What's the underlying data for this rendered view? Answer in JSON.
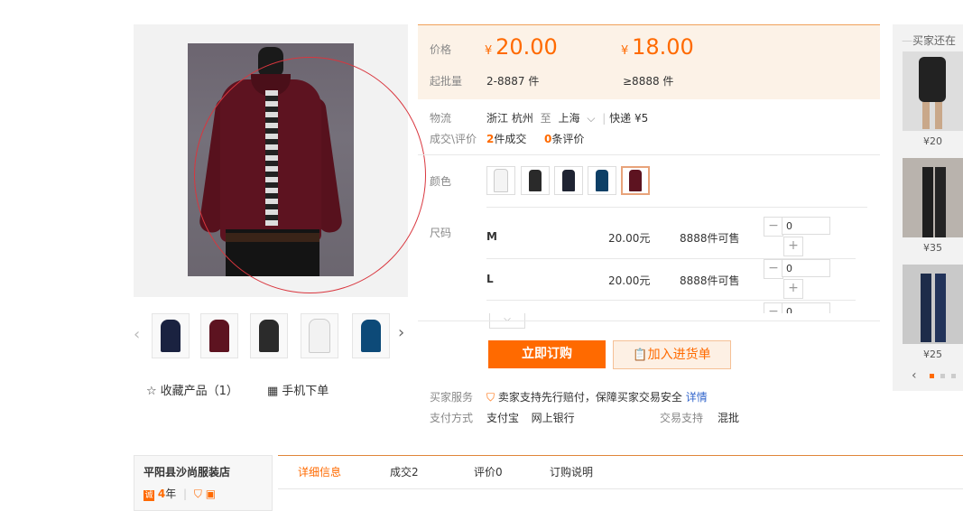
{
  "gallery": {
    "favorite_label": "收藏产品（1）",
    "mobile_order_label": "手机下单",
    "thumb_colors": [
      "#1a2240",
      "#5d1320",
      "#2b2b2b",
      "#f2f2f2",
      "#0d4a78"
    ]
  },
  "price": {
    "price_label": "价格",
    "currency": "¥",
    "price1": "20.00",
    "price2": "18.00",
    "moq_label": "起批量",
    "moq1": "2-8887 件",
    "moq2": "≥8888 件"
  },
  "logistics": {
    "label": "物流",
    "from": "浙江 杭州",
    "to_word": "至",
    "to": "上海",
    "express": "快递 ¥5"
  },
  "deals": {
    "label": "成交\\评价",
    "count": "2",
    "count_suffix": "件成交",
    "reviews": "0",
    "reviews_suffix": "条评价"
  },
  "color": {
    "label": "颜色",
    "swatches": [
      "#f4f4f4",
      "#2a2a2a",
      "#1f2433",
      "#0d3f66",
      "#5d1320"
    ]
  },
  "size": {
    "label": "尺码",
    "rows": [
      {
        "name": "M",
        "price": "20.00元",
        "stock": "8888件可售",
        "qty": "0"
      },
      {
        "name": "L",
        "price": "20.00元",
        "stock": "8888件可售",
        "qty": "0"
      },
      {
        "qty": "0"
      }
    ]
  },
  "actions": {
    "order_label": "立即订购",
    "cart_label": "加入进货单"
  },
  "service": {
    "label": "买家服务",
    "text": "卖家支持先行赔付，保障买家交易安全",
    "detail_link": "详情",
    "pay_label": "支付方式",
    "pay_alipay": "支付宝",
    "pay_bank": "网上银行",
    "trade_label": "交易支持",
    "trade_value": "混批"
  },
  "recommend": {
    "title": "买家还在",
    "items": [
      {
        "price": "¥20"
      },
      {
        "price": "¥35"
      },
      {
        "price": "¥25"
      }
    ]
  },
  "shop": {
    "name": "平阳县沙尚服装店",
    "years": "4",
    "years_suffix": "年"
  },
  "tabs": [
    "详细信息",
    "成交2",
    "评价0",
    "订购说明"
  ],
  "colors": {
    "accent": "#ff6a00",
    "link": "#3366cc",
    "price_bg": "#fcf2e7"
  }
}
